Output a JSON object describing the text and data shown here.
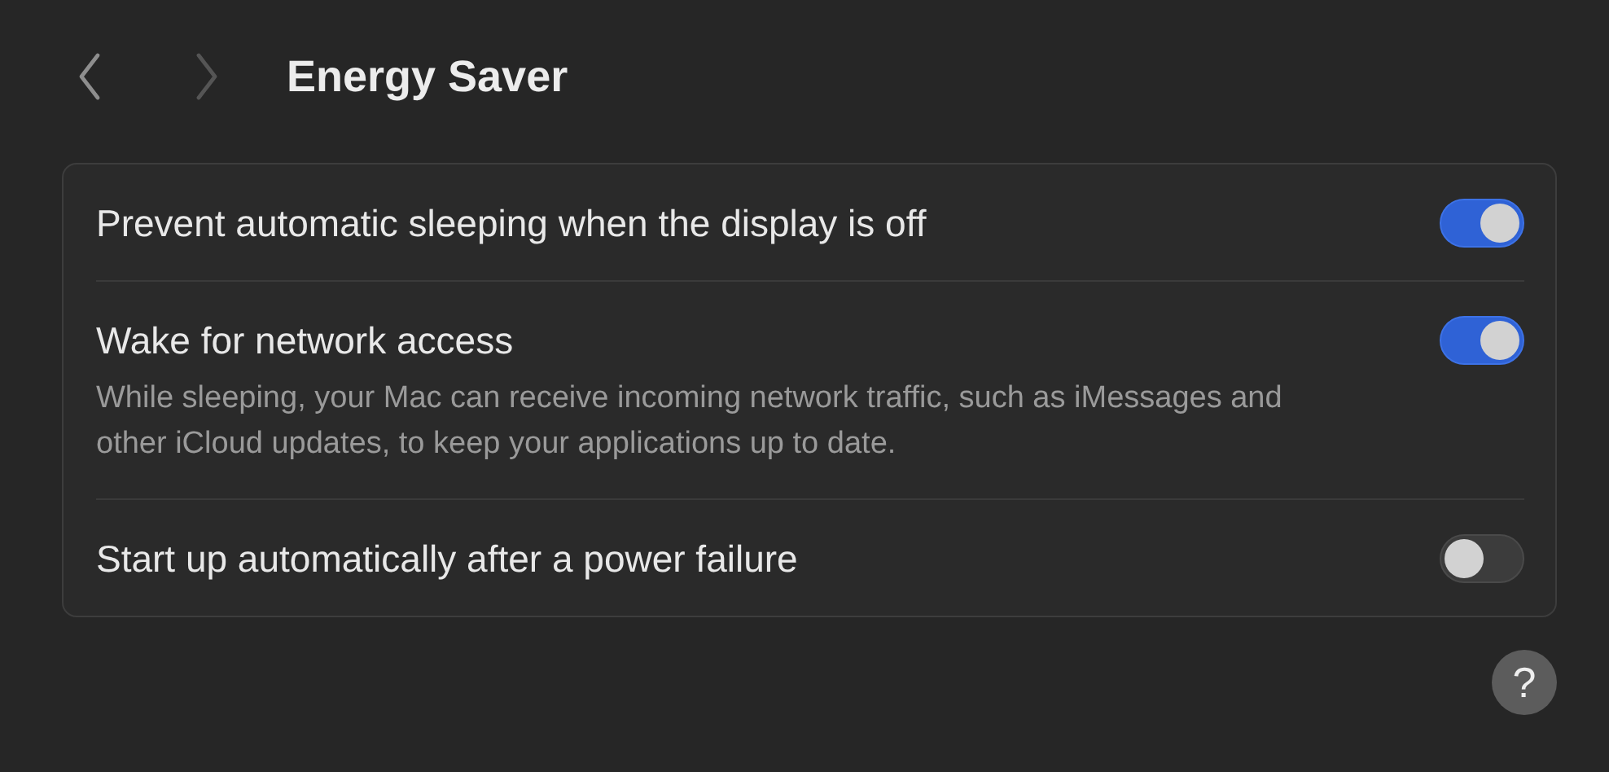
{
  "nav": [
    {
      "kind": "back",
      "disabled": false
    },
    {
      "kind": "forward",
      "disabled": true
    }
  ],
  "title": "Energy Saver",
  "settings": [
    {
      "label": "Prevent automatic sleeping when the display is off",
      "on": true
    },
    {
      "label": "Wake for network access",
      "description": "While sleeping, your Mac can receive incoming network traffic, such as iMessages and other iCloud updates, to keep your applications up to date.",
      "on": true
    },
    {
      "label": "Start up automatically after a power failure",
      "on": false
    }
  ],
  "help": "?"
}
